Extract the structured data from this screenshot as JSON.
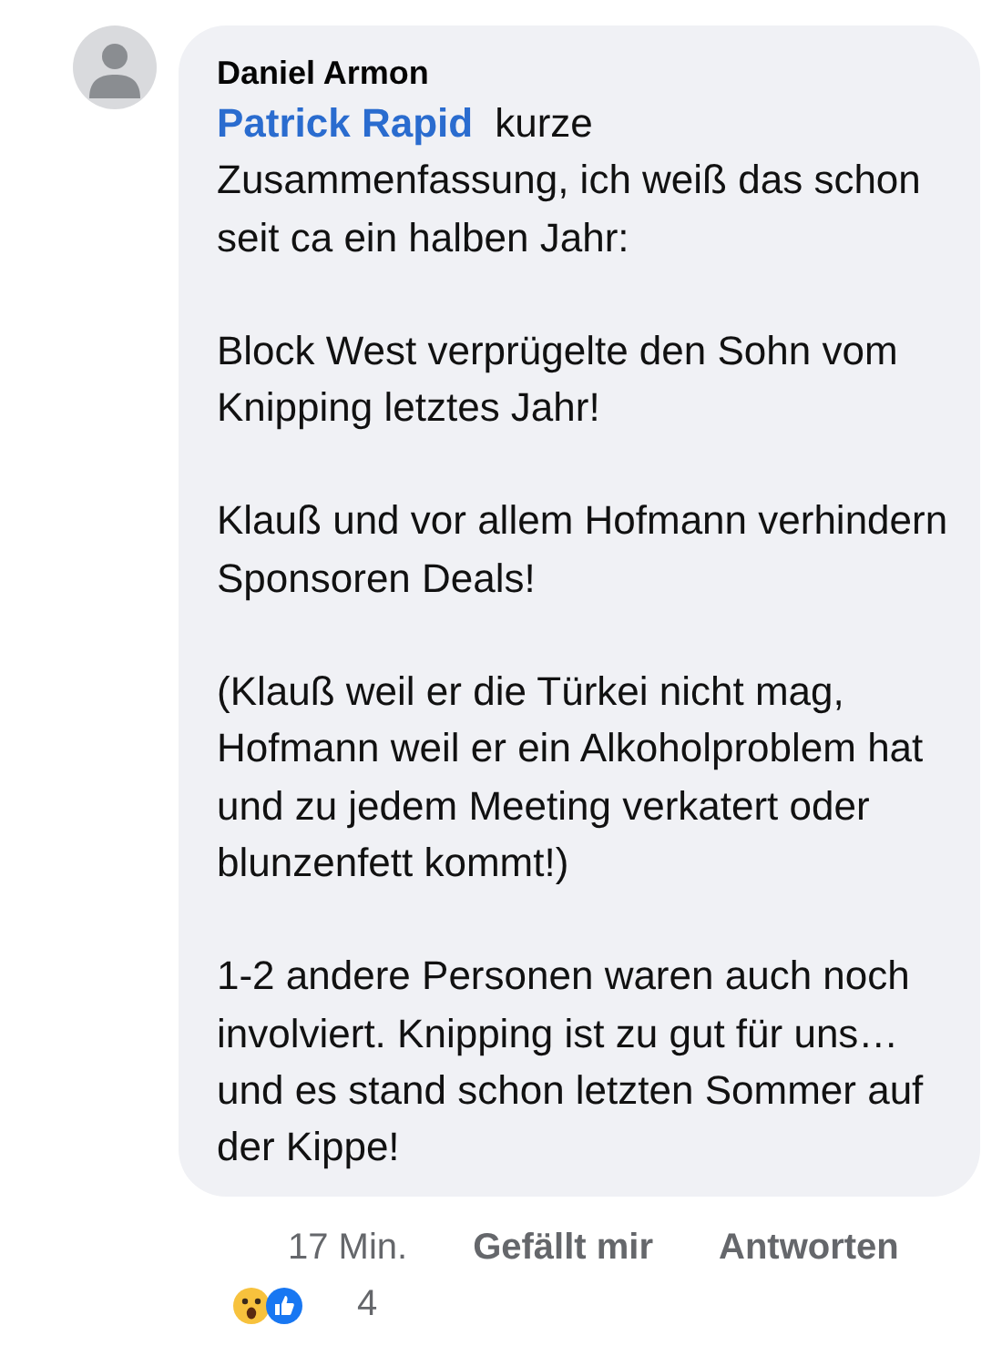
{
  "comment": {
    "author": "Daniel Armon",
    "mention": "Patrick Rapid",
    "paragraphs": [
      "kurze Zusammenfassung, ich weiß das schon seit ca ein halben Jahr:",
      "Block West verprügelte den Sohn vom Knipping letztes Jahr!",
      "Klauß und vor allem Hofmann verhindern Sponsoren Deals!",
      "(Klauß weil er die Türkei nicht mag, Hofmann weil er ein Alkoholproblem hat und zu jedem Meeting verkatert oder blunzenfett kommt!)",
      "1-2 andere Personen waren auch noch involviert. Knipping ist zu gut für uns…und es stand schon letzten Sommer auf der Kippe!"
    ],
    "time": "17 Min.",
    "actions": [
      "Gefällt mir",
      "Antworten"
    ],
    "reactions": {
      "items": [
        {
          "kind": "wow"
        },
        {
          "kind": "like"
        }
      ],
      "count": "4"
    }
  }
}
